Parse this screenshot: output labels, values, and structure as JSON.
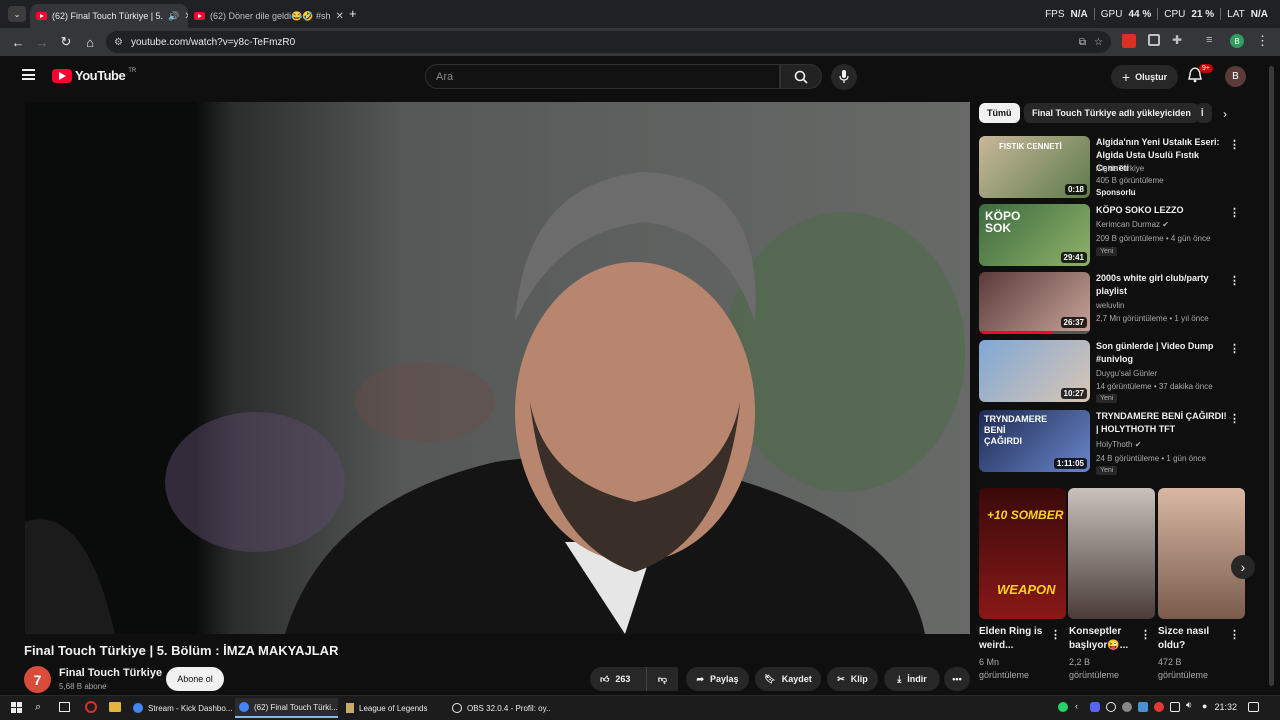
{
  "browser": {
    "tabs": [
      {
        "title": "(62) Final Touch Türkiye | 5.",
        "active": true
      },
      {
        "title": "(62) Döner dile geldi😂🤣 #sh",
        "active": false
      }
    ],
    "new_tab": "+",
    "url": "youtube.com/watch?v=y8c-TeFmzR0",
    "stats": {
      "fps_label": "FPS",
      "fps": "N/A",
      "gpu_label": "GPU",
      "gpu": "44 %",
      "cpu_label": "CPU",
      "cpu": "21 %",
      "lat_label": "LAT",
      "lat": "N/A"
    }
  },
  "yt": {
    "logo": "YouTube",
    "region": "TR",
    "search_placeholder": "Ara",
    "create_label": "Oluştur",
    "notif_count": "9+",
    "avatar_letter": "B"
  },
  "video": {
    "title": "Final Touch Türkiye | 5. Bölüm : İMZA MAKYAJLAR",
    "channel": "Final Touch Türkiye",
    "channel_initial": "7",
    "subs": "5,68 B abone",
    "subscribe": "Abone ol",
    "likes": "263",
    "share": "Paylaş",
    "save": "Kaydet",
    "clip": "Klip",
    "download": "İndir"
  },
  "chips": [
    "Tümü",
    "Final Touch Türkiye adlı yükleyiciden",
    "İ"
  ],
  "recs": [
    {
      "title": "Algida'nın Yeni Ustalık Eseri: Algida Usta Usulü Fıstık Cenneti",
      "channel": "AlgidaTurkiye",
      "meta": "405 B görüntüleme",
      "extra": "Sponsorlu",
      "duration": "0:18",
      "thumb_text": "FISTIK CENNETİ",
      "thumb_colors": [
        "#c8b89a",
        "#5e7a4c"
      ]
    },
    {
      "title": "KÖPO SOKO LEZZO",
      "channel": "Kerimcan Durmaz",
      "verified": true,
      "meta": "209 B görüntüleme • 4 gün önce",
      "badge": "Yeni",
      "duration": "29:41",
      "thumb_text": "KÖPO SOK",
      "thumb_colors": [
        "#3d6b3f",
        "#8fb26a"
      ]
    },
    {
      "title": "2000s white girl club/party playlist",
      "channel": "weluvlin",
      "meta": "2,7 Mn görüntüleme • 1 yıl önce",
      "duration": "26:37",
      "thumb_text": "",
      "thumb_colors": [
        "#5a3a3a",
        "#c8a59a"
      ],
      "progress": 0.66
    },
    {
      "title": "Son günlerde | Video Dump #univlog",
      "channel": "Duygu'sal Günler",
      "meta": "14 görüntüleme • 37 dakika önce",
      "badge": "Yeni",
      "duration": "10:27",
      "thumb_text": "",
      "thumb_colors": [
        "#7fa7d6",
        "#d9c6b4"
      ]
    },
    {
      "title": "TRYNDAMERE BENİ ÇAĞIRDI! | HOLYTHOTH TFT",
      "channel": "HolyThoth",
      "verified": true,
      "meta": "24 B görüntüleme • 1 gün önce",
      "badge": "Yeni",
      "duration": "1:11:05",
      "thumb_text": "TRYNDAMERE BENİ ÇAĞIRDI",
      "thumb_colors": [
        "#1d2a52",
        "#6a86c9"
      ]
    }
  ],
  "shorts": [
    {
      "title": "Elden Ring is weird...",
      "meta": "6 Mn görüntüleme",
      "thumb_text_top": "+10 SOMBER",
      "thumb_text_bottom": "WEAPON",
      "colors": [
        "#3a0a0a",
        "#8a1818"
      ]
    },
    {
      "title": "Konseptler başlıyor😜...",
      "meta": "2,2 B görüntüleme",
      "colors": [
        "#c9c1bc",
        "#4a3d38"
      ]
    },
    {
      "title": "Sizce nasıl oldu?",
      "meta": "472 B görüntüleme",
      "colors": [
        "#d9b7a4",
        "#7a5b4c"
      ]
    }
  ],
  "taskbar": {
    "items": [
      "Stream - Kick Dashbo...",
      "(62) Final Touch Türki...",
      "League of Legends",
      "OBS 32.0.4 - Profil: oy..."
    ],
    "clock": "21:32"
  }
}
